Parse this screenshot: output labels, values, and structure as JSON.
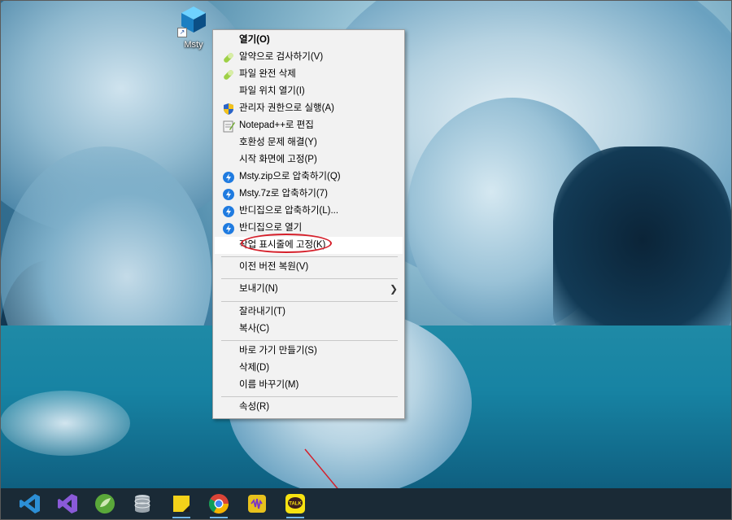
{
  "desktop": {
    "icon_label": "Msty"
  },
  "context_menu": {
    "items": [
      {
        "label": "열기(O)",
        "icon": "none",
        "bold": true
      },
      {
        "label": "알약으로 검사하기(V)",
        "icon": "pill-icon"
      },
      {
        "label": "파일 완전 삭제",
        "icon": "pill-icon"
      },
      {
        "label": "파일 위치 열기(I)",
        "icon": "none"
      },
      {
        "label": "관리자 권한으로 실행(A)",
        "icon": "uac-shield-icon"
      },
      {
        "label": "Notepad++로 편집",
        "icon": "notepadpp-icon"
      },
      {
        "label": "호환성 문제 해결(Y)",
        "icon": "none"
      },
      {
        "label": "시작 화면에 고정(P)",
        "icon": "none"
      },
      {
        "label": "Msty.zip으로 압축하기(Q)",
        "icon": "bandizip-icon"
      },
      {
        "label": "Msty.7z로 압축하기(7)",
        "icon": "bandizip-icon"
      },
      {
        "label": "반디집으로 압축하기(L)...",
        "icon": "bandizip-icon"
      },
      {
        "label": "반디집으로 열기",
        "icon": "bandizip-icon"
      },
      {
        "label": "작업 표시줄에 고정(K)",
        "icon": "none",
        "highlighted": true
      },
      {
        "label": "이전 버전 복원(V)",
        "icon": "none"
      },
      {
        "label": "보내기(N)",
        "icon": "none",
        "submenu": true
      },
      {
        "label": "잘라내기(T)",
        "icon": "none"
      },
      {
        "label": "복사(C)",
        "icon": "none"
      },
      {
        "label": "바로 가기 만들기(S)",
        "icon": "none"
      },
      {
        "label": "삭제(D)",
        "icon": "none"
      },
      {
        "label": "이름 바꾸기(M)",
        "icon": "none"
      },
      {
        "label": "속성(R)",
        "icon": "none"
      }
    ]
  },
  "taskbar": {
    "apps": [
      {
        "name": "vscode-icon",
        "color": "#2c8fd6"
      },
      {
        "name": "visual-studio-icon",
        "color": "#8a5ad8"
      },
      {
        "name": "spring-tools-icon",
        "color": "#5aa83a"
      },
      {
        "name": "database-icon",
        "color": "#9aa4ac"
      },
      {
        "name": "sticky-notes-icon",
        "color": "#f4d21a"
      },
      {
        "name": "chrome-icon",
        "color": "#db4437"
      },
      {
        "name": "audio-app-icon",
        "color": "#e7c11d"
      },
      {
        "name": "kakaotalk-icon",
        "color": "#f7e211",
        "text": "TALK"
      }
    ]
  },
  "annotation_color": "#d51f2a"
}
